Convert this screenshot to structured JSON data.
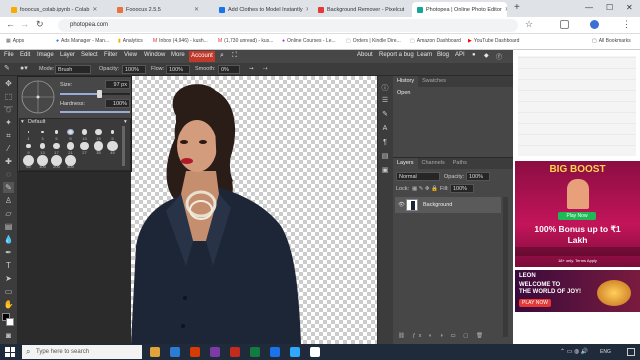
{
  "browser": {
    "tabs": [
      {
        "label": "fooocus_colab.ipynb - Colab",
        "color": "#f9ab00",
        "active": false
      },
      {
        "label": "Fooocus 2.5.5",
        "color": "#e8743b",
        "active": false
      },
      {
        "label": "Add Clothes to Model Instantly",
        "color": "#1a73e8",
        "active": false
      },
      {
        "label": "Background Remover - Pixelcut",
        "color": "#e53935",
        "active": false
      },
      {
        "label": "Photopea | Online Photo Editor",
        "color": "#18a497",
        "active": true
      }
    ],
    "new_tab": "+",
    "url": "photopea.com",
    "bookmarks": [
      {
        "label": "Apps"
      },
      {
        "label": "Ads Manager - Man..."
      },
      {
        "label": "Analytics"
      },
      {
        "label": "Inbox (4,946) - kush..."
      },
      {
        "label": "(1,730 unread) - kus..."
      },
      {
        "label": "Online Courses - Le..."
      },
      {
        "label": "Orders | Kindle Dire..."
      },
      {
        "label": "Amazon Dashboard"
      },
      {
        "label": "YouTube Dashboard"
      }
    ],
    "all_bookmarks": "All Bookmarks"
  },
  "menubar": {
    "items": [
      "File",
      "Edit",
      "Image",
      "Layer",
      "Select",
      "Filter",
      "View",
      "Window",
      "More"
    ],
    "account": "Account",
    "right_items": [
      "About",
      "Report a bug",
      "Learn",
      "Blog",
      "API"
    ]
  },
  "options": {
    "mode_label": "Mode:",
    "mode_value": "Brush",
    "opacity_label": "Opacity:",
    "opacity_value": "100%",
    "flow_label": "Flow:",
    "flow_value": "100%",
    "smooth_label": "Smooth:",
    "smooth_value": "0%"
  },
  "brush_popup": {
    "size_label": "Size:",
    "size_value": "97 px",
    "size_level": 0.55,
    "hardness_label": "Hardness:",
    "hardness_value": "100%",
    "hardness_level": 1.0,
    "preset_group": "Default",
    "presets": [
      "1",
      "3",
      "5",
      "9",
      "13",
      "19",
      "5",
      "9",
      "13",
      "17",
      "21",
      "27",
      "35",
      "45",
      "65",
      "100",
      "200",
      "300"
    ]
  },
  "panels": {
    "top_tabs": [
      "History",
      "Swatches"
    ],
    "history_items": [
      "Open"
    ],
    "layer_tabs": [
      "Layers",
      "Channels",
      "Paths"
    ],
    "blend_mode": "Normal",
    "opacity_label": "Opacity:",
    "opacity_value": "100%",
    "lock_label": "Lock:",
    "fill_label": "Fill:",
    "fill_value": "100%",
    "layer_name": "Background"
  },
  "ads": {
    "ad1_title": "BIG BOOST",
    "ad1_button": "Play Now",
    "ad1_line1": "100% Bonus up to ₹1",
    "ad1_line2": "Lakh",
    "ad1_small": "18+ only. Terms Apply",
    "ad2_brand": "LEON",
    "ad2_line1": "WELCOME TO",
    "ad2_line2": "THE WORLD OF JOY!",
    "ad2_button": "PLAY NOW"
  },
  "taskbar": {
    "search_placeholder": "Type here to search",
    "lang": "ENG",
    "app_colors": [
      "#e2a33a",
      "#2b7cd3",
      "#d83b01",
      "#7d3ba8",
      "#c42b1c",
      "#107c41",
      "#1a73e8",
      "#31a8ff",
      "#ffffff"
    ]
  },
  "colors": {
    "ps_menu": "#474747",
    "ps_panel": "#3c3c3c",
    "account": "#c0392b"
  }
}
